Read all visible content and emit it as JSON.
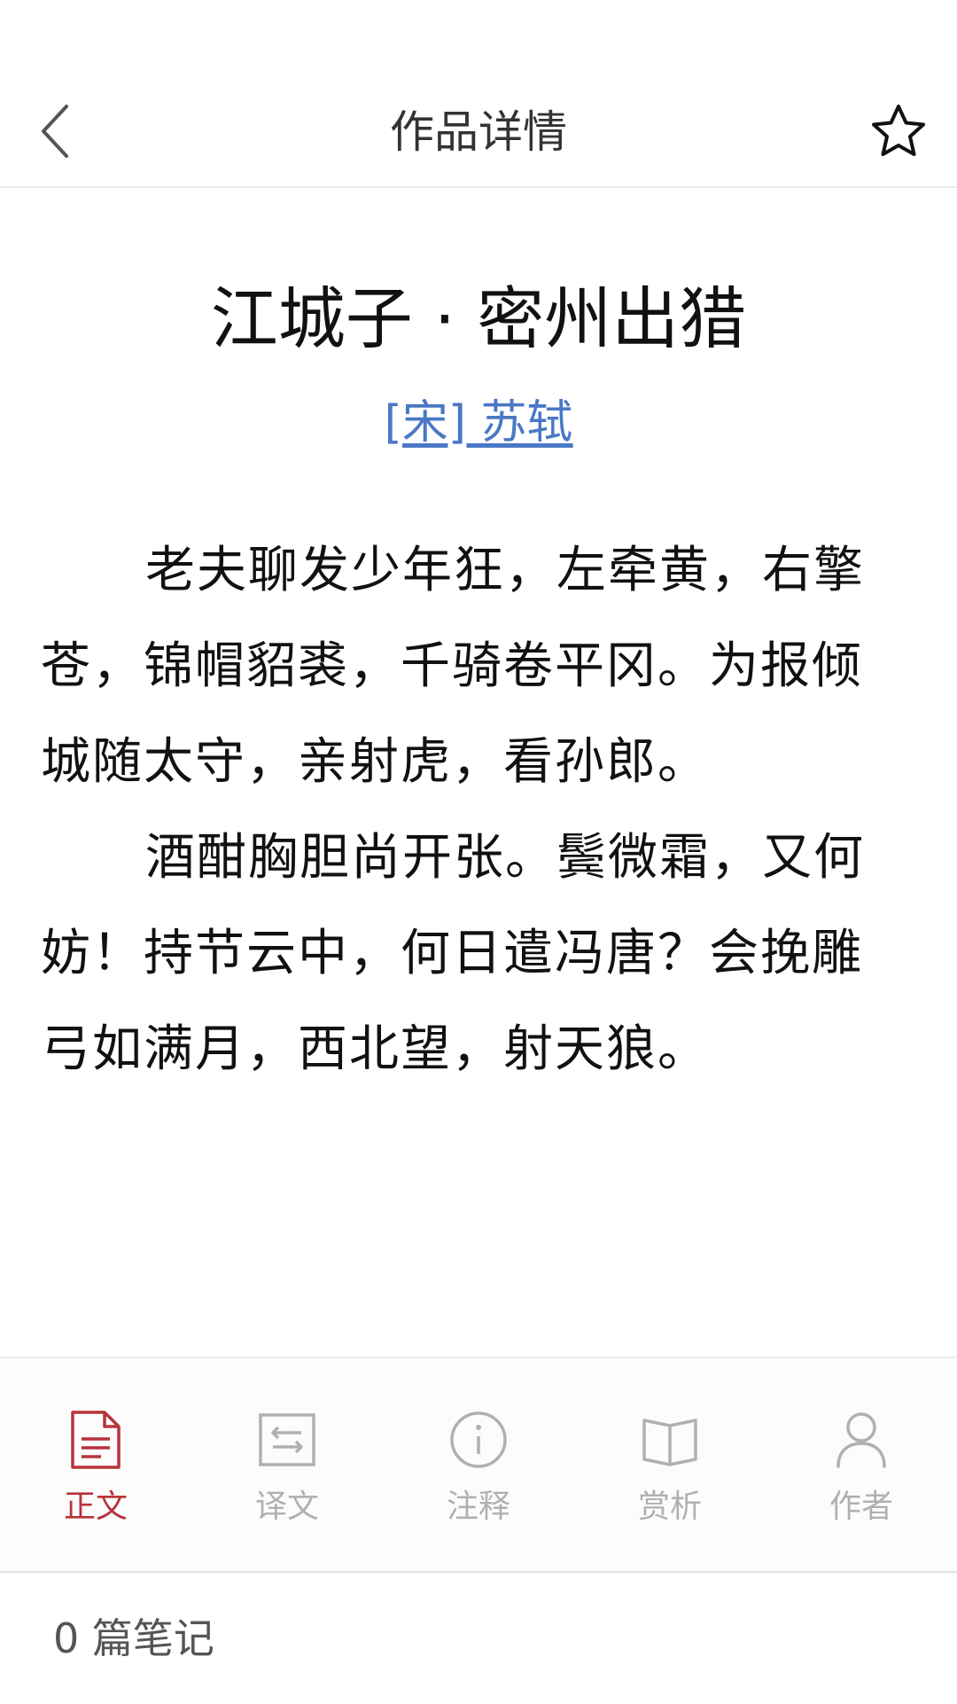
{
  "header": {
    "title": "作品详情",
    "back_icon": "chevron-left-icon",
    "favorite_icon": "star-outline-icon"
  },
  "poem": {
    "title": "江城子 · 密州出猎",
    "author": "[宋] 苏轼",
    "paragraphs": [
      "老夫聊发少年狂，左牵黄，右擎苍，锦帽貂裘，千骑卷平冈。为报倾城随太守，亲射虎，看孙郎。",
      "酒酣胸胆尚开张。鬓微霜，又何妨！持节云中，何日遣冯唐？会挽雕弓如满月，西北望，射天狼。"
    ]
  },
  "tabs": [
    {
      "label": "正文",
      "icon": "document-icon",
      "active": true
    },
    {
      "label": "译文",
      "icon": "translate-icon",
      "active": false
    },
    {
      "label": "注释",
      "icon": "info-icon",
      "active": false
    },
    {
      "label": "赏析",
      "icon": "open-book-icon",
      "active": false
    },
    {
      "label": "作者",
      "icon": "user-icon",
      "active": false
    }
  ],
  "notes": {
    "label": "0 篇笔记"
  },
  "colors": {
    "accent": "#b8333a",
    "link": "#4a78c6",
    "inactive": "#b0b0b0"
  }
}
